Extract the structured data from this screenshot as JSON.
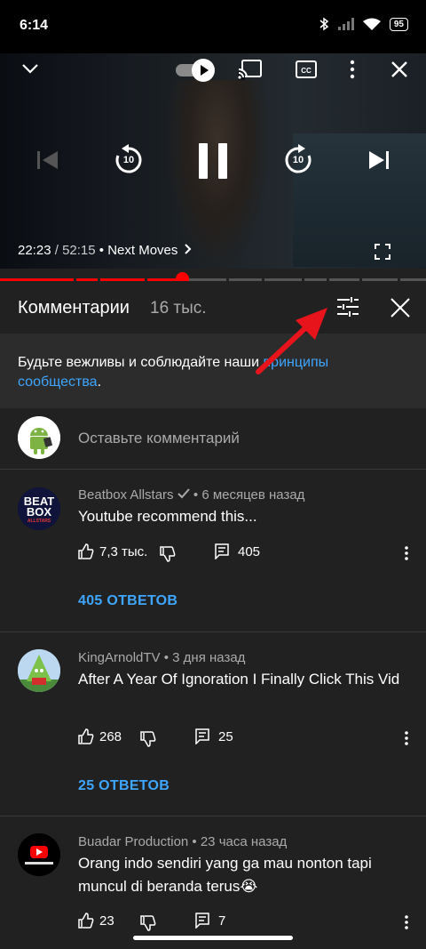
{
  "status_bar": {
    "time": "6:14",
    "battery": "95"
  },
  "player": {
    "current_time": "22:23",
    "separator": " / ",
    "duration": "52:15",
    "next_label": " • Next Moves",
    "seek_back": "10",
    "seek_forward": "10",
    "progress_fraction": 0.427
  },
  "comments_panel": {
    "title": "Комментарии",
    "count": "16 тыс.",
    "notice_text": "Будьте вежливы и соблюдайте наши ",
    "notice_link": "принципы сообщества",
    "notice_end": ".",
    "input_placeholder": "Оставьте комментарий"
  },
  "comments": [
    {
      "author": "Beatbox Allstars",
      "meta": " • 6 месяцев назад",
      "text": "Youtube recommend this...",
      "likes": "7,3 тыс.",
      "replies_count": "405",
      "replies_label": "405 ОТВЕТОВ",
      "avatar_text": [
        "BEAT",
        "BOX",
        "ALLSTARS"
      ]
    },
    {
      "author": "KingArnoldTV",
      "meta": " • 3 дня назад",
      "text": "After A Year Of Ignoration I Finally Click This Vid",
      "likes": "268",
      "replies_count": "25",
      "replies_label": "25 ОТВЕТОВ"
    },
    {
      "author": "Buadar Production",
      "meta": " • 23 часа назад",
      "text": "Orang indo sendiri yang ga mau nonton tapi muncul di beranda terus😭",
      "likes": "23",
      "replies_count": "7"
    }
  ],
  "colors": {
    "accent_red": "#ff0000",
    "link_blue": "#3ea6ff",
    "background": "#212121"
  }
}
